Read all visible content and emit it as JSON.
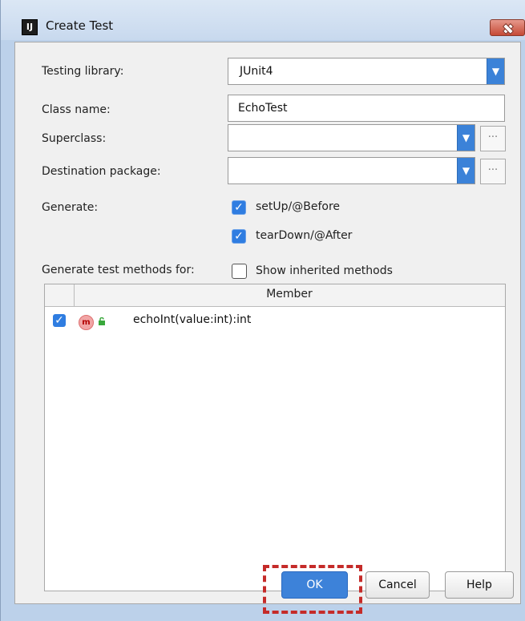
{
  "window": {
    "title": "Create Test",
    "app_icon": "IJ"
  },
  "form": {
    "testing_library_label": "Testing library:",
    "testing_library_value": "JUnit4",
    "class_name_label": "Class name:",
    "class_name_value": "EchoTest",
    "superclass_label": "Superclass:",
    "superclass_value": "",
    "destination_package_label": "Destination package:",
    "destination_package_value": "",
    "generate_label": "Generate:",
    "setup_label": "setUp/@Before",
    "teardown_label": "tearDown/@After",
    "generate_test_methods_label": "Generate test methods for:",
    "show_inherited_label": "Show inherited methods"
  },
  "table": {
    "header_member": "Member",
    "rows": [
      {
        "checked": true,
        "member": "echoInt(value:int):int",
        "icon": "method-icon",
        "access_icon": "public-lock-icon"
      }
    ]
  },
  "buttons": {
    "ok": "OK",
    "cancel": "Cancel",
    "help": "Help"
  },
  "icons": {
    "dropdown": "▼",
    "browse": "...",
    "check": "✓",
    "method": "m"
  },
  "colors": {
    "accent": "#2f7de1",
    "highlight": "#c52b29"
  }
}
